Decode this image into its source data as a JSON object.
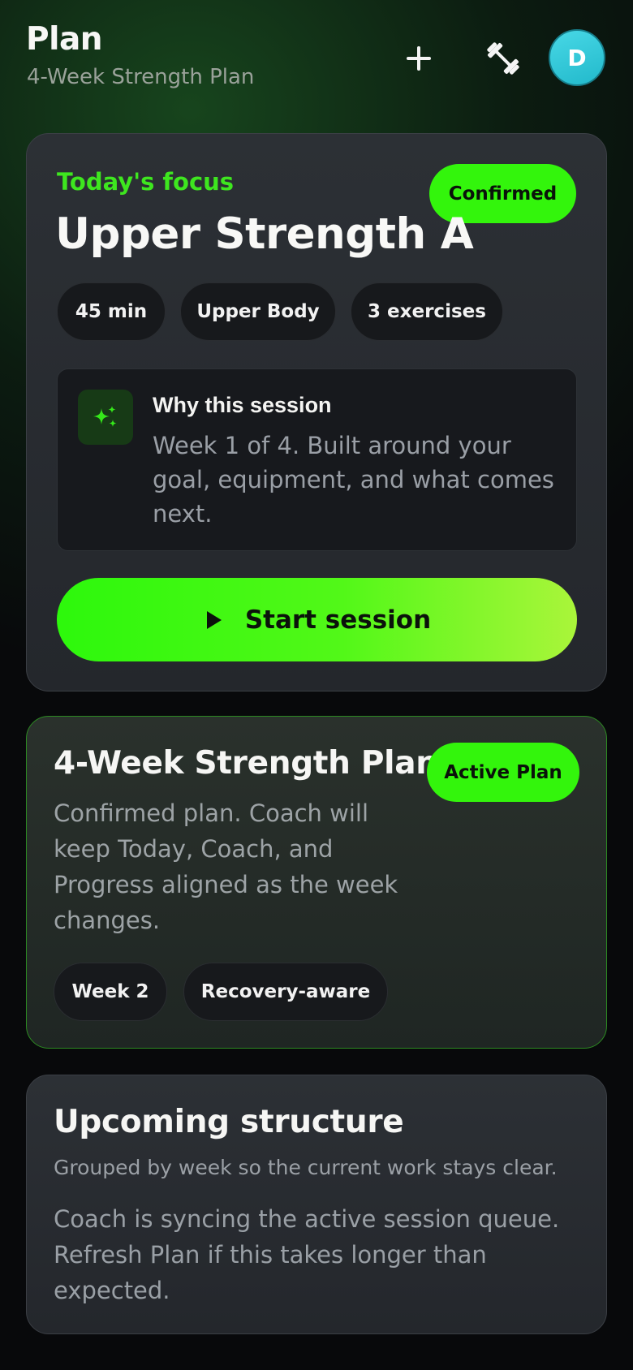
{
  "header": {
    "title": "Plan",
    "subtitle": "4-Week Strength Plan",
    "add_icon": "plus-icon",
    "workout_icon": "dumbbell-icon",
    "avatar_initial": "D"
  },
  "today": {
    "focus_label": "Today's focus",
    "status_badge": "Confirmed",
    "session_title": "Upper Strength A",
    "chips": [
      "45 min",
      "Upper Body",
      "3 exercises"
    ],
    "why": {
      "icon": "sparkle-icon",
      "title": "Why this session",
      "body": "Week 1 of 4. Built around your goal, equipment, and what comes next."
    },
    "start_button": {
      "icon": "play-icon",
      "label": "Start session"
    }
  },
  "active_plan": {
    "title": "4-Week Strength Plan",
    "badge": "Active Plan",
    "body": "Confirmed plan. Coach will keep Today, Coach, and Progress aligned as the week changes.",
    "chips": [
      "Week 2",
      "Recovery-aware"
    ]
  },
  "upcoming": {
    "title": "Upcoming structure",
    "subtitle": "Grouped by week so the current work stays clear.",
    "body": "Coach is syncing the active session queue. Refresh Plan if this takes longer than expected."
  },
  "colors": {
    "accent_green": "#33f50c",
    "focus_label_green": "#3ee61f",
    "avatar_teal": "#2fc6d6",
    "card_bg": "#282c31",
    "page_bg": "#08090b"
  }
}
